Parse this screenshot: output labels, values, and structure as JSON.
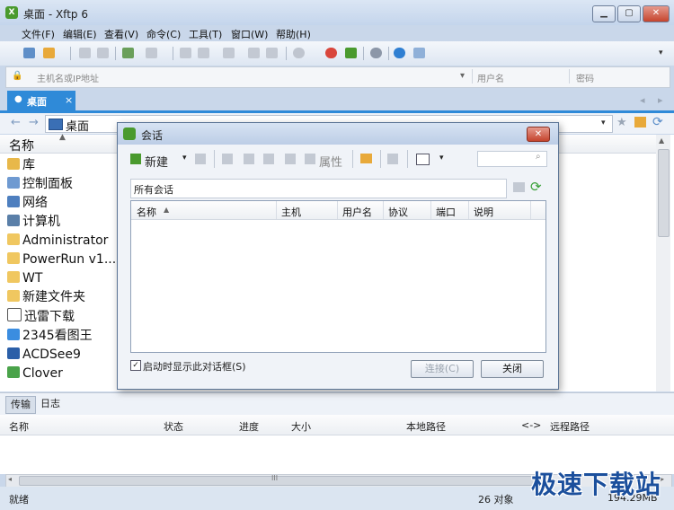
{
  "window": {
    "title": "桌面 - Xftp 6",
    "icon_text": "X",
    "colors": {
      "accent": "#2f8ad8",
      "title_grad_top": "#dbe6f4"
    }
  },
  "menu": [
    "文件(F)",
    "编辑(E)",
    "查看(V)",
    "命令(C)",
    "工具(T)",
    "窗口(W)",
    "帮助(H)"
  ],
  "address_bar": {
    "host_placeholder": "主机名或IP地址",
    "user_placeholder": "用户名",
    "password_placeholder": "密码"
  },
  "tabs": [
    {
      "label": "桌面",
      "close": "×"
    }
  ],
  "path": {
    "location": "桌面"
  },
  "file_list": {
    "header": "名称",
    "items": [
      {
        "name": "库",
        "icon": "library-icon"
      },
      {
        "name": "控制面板",
        "icon": "control-panel-icon"
      },
      {
        "name": "网络",
        "icon": "network-icon"
      },
      {
        "name": "计算机",
        "icon": "computer-icon"
      },
      {
        "name": "Administrator",
        "icon": "folder-icon"
      },
      {
        "name": "PowerRun v1....",
        "icon": "folder-icon"
      },
      {
        "name": "WT",
        "icon": "folder-icon"
      },
      {
        "name": "新建文件夹",
        "icon": "folder-icon"
      },
      {
        "name": "迅雷下载",
        "icon": "shortcut-icon"
      },
      {
        "name": "2345看图王",
        "icon": "app-icon"
      },
      {
        "name": "ACDSee9",
        "icon": "app-icon"
      },
      {
        "name": "Clover",
        "icon": "app-icon"
      }
    ]
  },
  "session_dialog": {
    "title": "会话",
    "toolbar": {
      "new_label": "新建",
      "properties_label": "属性"
    },
    "folder": "所有会话",
    "columns": [
      "名称",
      "主机",
      "用户名",
      "协议",
      "端口",
      "说明"
    ],
    "show_on_startup": {
      "label": "启动时显示此对话框(S)",
      "checked": true
    },
    "connect_label": "连接(C)",
    "close_label": "关闭"
  },
  "lower_tabs": [
    "传输",
    "日志"
  ],
  "transfer_columns": {
    "name": "名称",
    "status": "状态",
    "progress": "进度",
    "size": "大小",
    "local_path": "本地路径",
    "arrow": "<->",
    "remote_path": "远程路径"
  },
  "hscroll_grip": "III",
  "status": {
    "text": "就绪",
    "objects": "26 对象",
    "size": "194.29MB"
  },
  "watermark": "极速下载站"
}
